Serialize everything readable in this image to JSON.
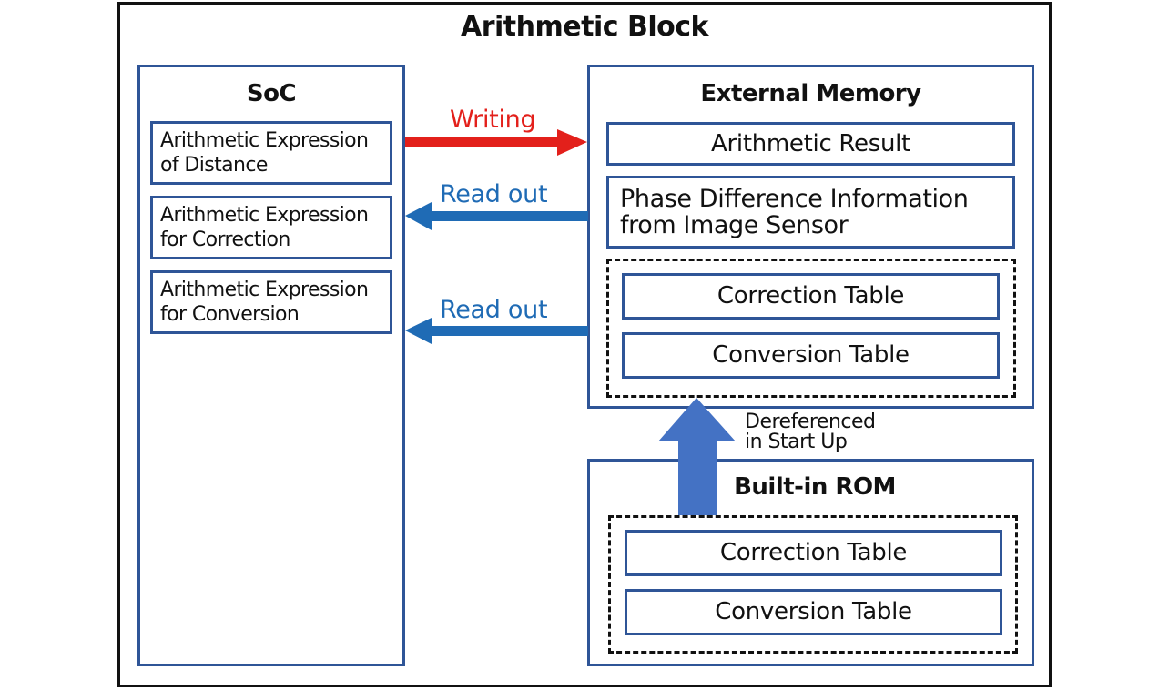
{
  "title": "Arithmetic Block",
  "soc": {
    "heading": "SoC",
    "items": [
      {
        "line1": "Arithmetic Expression",
        "line2": "of Distance"
      },
      {
        "line1": "Arithmetic Expression",
        "line2": "for Correction"
      },
      {
        "line1": "Arithmetic Expression",
        "line2": "for Conversion"
      }
    ]
  },
  "external_memory": {
    "heading": "External Memory",
    "arithmetic_result": "Arithmetic Result",
    "phase_info": {
      "line1": "Phase Difference Information",
      "line2": "from Image Sensor"
    },
    "tables": [
      "Correction Table",
      "Conversion Table"
    ]
  },
  "builtin_rom": {
    "heading": "Built-in ROM",
    "tables": [
      "Correction Table",
      "Conversion Table"
    ]
  },
  "arrows": {
    "writing": "Writing",
    "read_out_1": "Read out",
    "read_out_2": "Read out",
    "dereferenced": {
      "line1": "Dereferenced",
      "line2": "in Start Up"
    }
  },
  "colors": {
    "box_border": "#2f5597",
    "writing_arrow": "#e3201b",
    "read_arrow": "#1f6bb5",
    "startup_arrow": "#4472c4"
  }
}
